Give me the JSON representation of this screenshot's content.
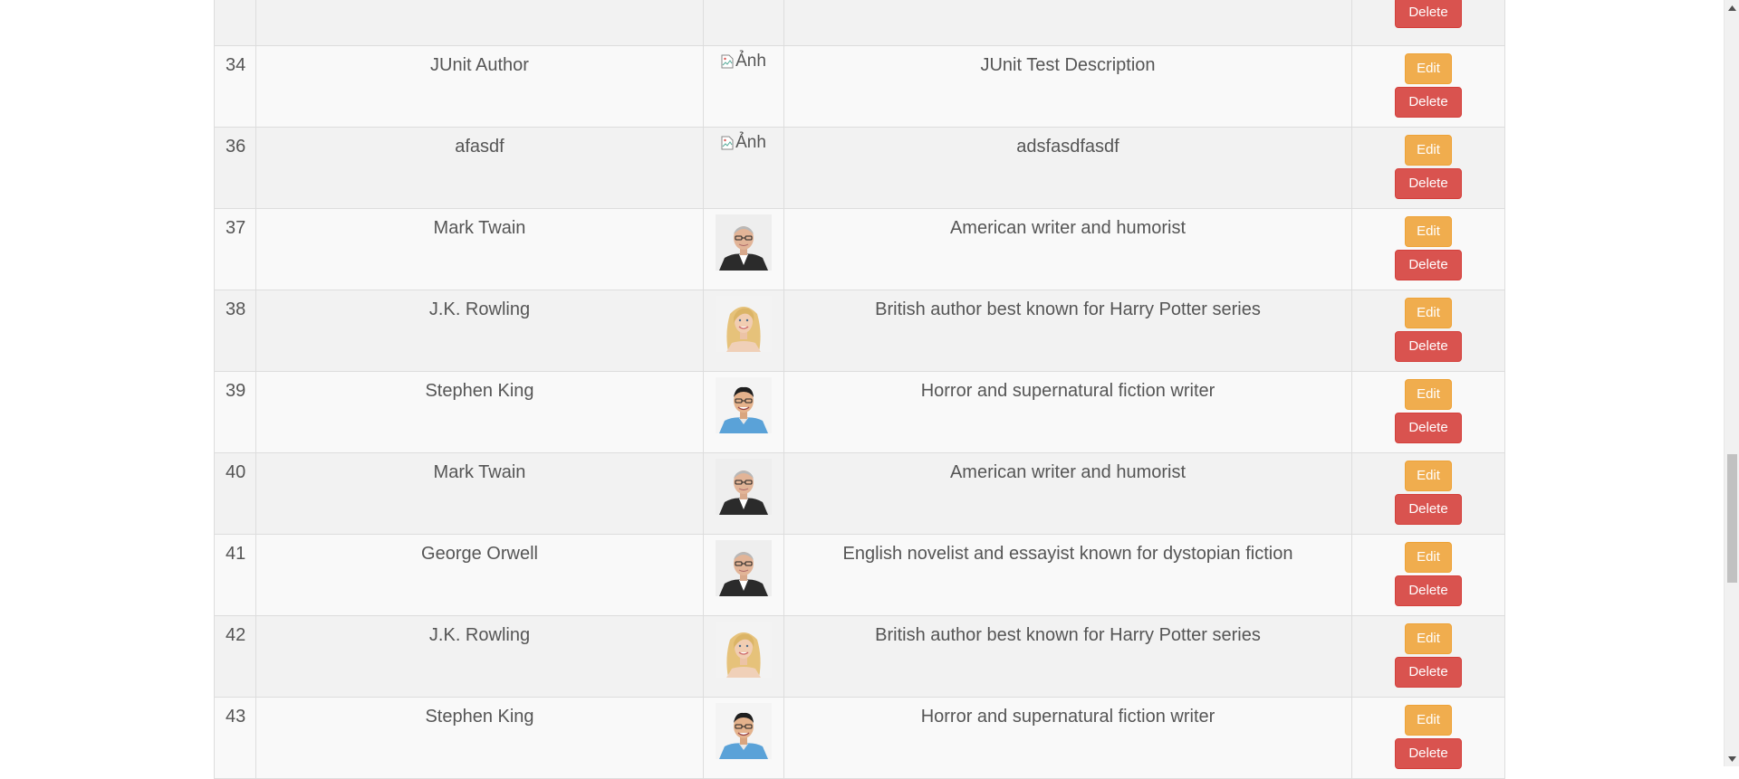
{
  "buttons": {
    "edit_label": "Edit",
    "delete_label": "Delete"
  },
  "broken_image_alt": "Ảnh",
  "colors": {
    "edit": "#f0ad4e",
    "delete": "#d9534f",
    "row_odd": "#f2f2f2",
    "row_even": "#f9f9f9",
    "text": "#555555"
  },
  "rows": [
    {
      "id": "",
      "name": "",
      "image": "none",
      "description": "",
      "show_edit": false
    },
    {
      "id": "34",
      "name": "JUnit Author",
      "image": "broken",
      "description": "JUnit Test Description",
      "show_edit": true
    },
    {
      "id": "36",
      "name": "afasdf",
      "image": "broken",
      "description": "adsfasdfasdf",
      "show_edit": true
    },
    {
      "id": "37",
      "name": "Mark Twain",
      "image": "man-suit-glasses",
      "description": "American writer and humorist",
      "show_edit": true
    },
    {
      "id": "38",
      "name": "J.K. Rowling",
      "image": "woman-blonde",
      "description": "British author best known for Harry Potter series",
      "show_edit": true
    },
    {
      "id": "39",
      "name": "Stephen King",
      "image": "man-blue-shirt",
      "description": "Horror and supernatural fiction writer",
      "show_edit": true
    },
    {
      "id": "40",
      "name": "Mark Twain",
      "image": "man-suit-glasses",
      "description": "American writer and humorist",
      "show_edit": true
    },
    {
      "id": "41",
      "name": "George Orwell",
      "image": "man-suit-glasses",
      "description": "English novelist and essayist known for dystopian fiction",
      "show_edit": true
    },
    {
      "id": "42",
      "name": "J.K. Rowling",
      "image": "woman-blonde",
      "description": "British author best known for Harry Potter series",
      "show_edit": true
    },
    {
      "id": "43",
      "name": "Stephen King",
      "image": "man-blue-shirt",
      "description": "Horror and supernatural fiction writer",
      "show_edit": true
    }
  ]
}
